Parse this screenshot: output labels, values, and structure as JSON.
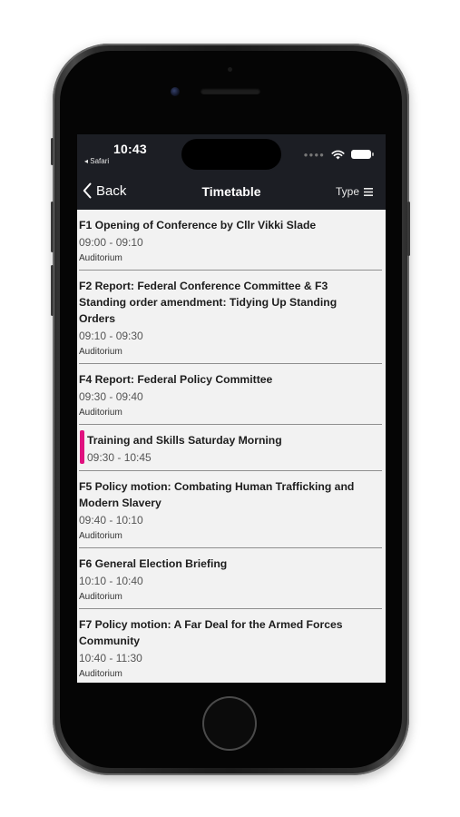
{
  "status_bar": {
    "time": "10:43",
    "back_app": "◂ Safari",
    "icons": [
      "cellular-dots-icon",
      "wifi-icon",
      "battery-icon"
    ]
  },
  "nav": {
    "back_label": "Back",
    "title": "Timetable",
    "type_label": "Type"
  },
  "sessions": [
    {
      "title": "F1 Opening of Conference by Cllr Vikki Slade",
      "time": "09:00 - 09:10",
      "room": "Auditorium"
    },
    {
      "title": "F2 Report: Federal Conference Committee & F3 Standing order amendment: Tidying Up Standing Orders",
      "time": "09:10 - 09:30",
      "room": "Auditorium"
    },
    {
      "title": "F4 Report: Federal Policy Committee",
      "time": "09:30 - 09:40",
      "room": "Auditorium"
    },
    {
      "title": "Training and Skills Saturday Morning",
      "time": "09:30 - 10:45",
      "accent_color": "#e0117f"
    },
    {
      "title": "F5 Policy motion: Combating Human Trafficking and Modern Slavery",
      "time": "09:40 - 10:10",
      "room": "Auditorium"
    },
    {
      "title": "F6 General Election Briefing",
      "time": "10:10 - 10:40",
      "room": "Auditorium"
    },
    {
      "title": "F7 Policy motion: A Far Deal for the Armed Forces Community",
      "time": "10:40 - 11:30",
      "room": "Auditorium"
    }
  ],
  "colors": {
    "nav_background": "#1c1e24",
    "list_background": "#f2f2f2",
    "accent": "#e0117f"
  }
}
